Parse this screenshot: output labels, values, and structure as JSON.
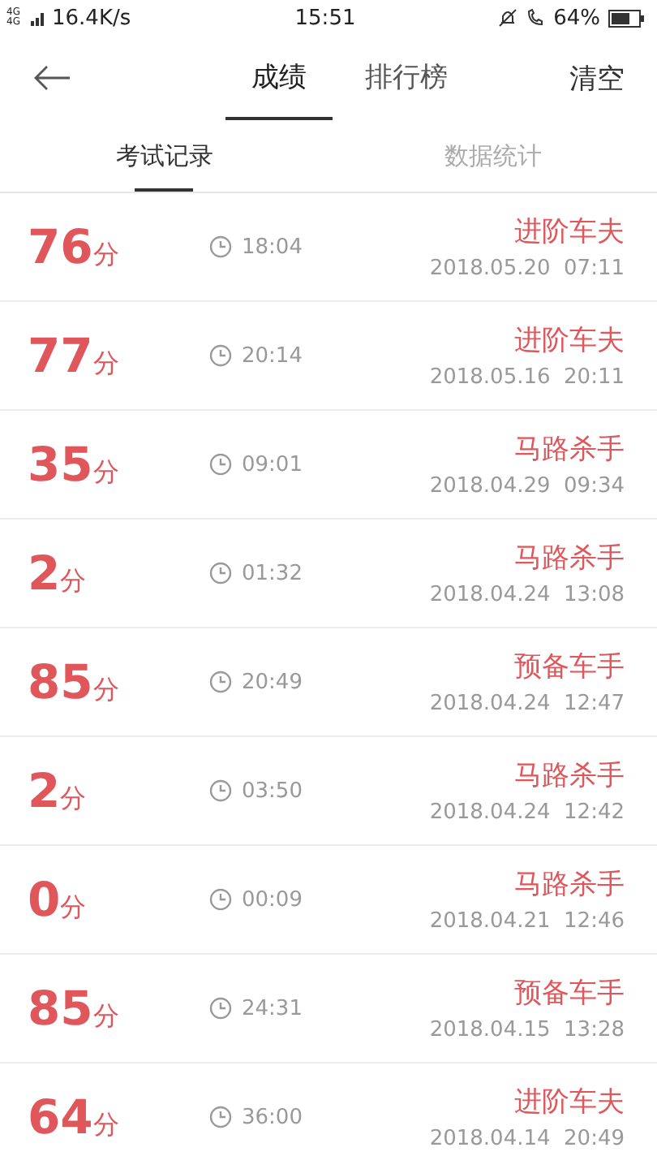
{
  "status_bar": {
    "signal": "4G 4G",
    "speed": "16.4K/s",
    "time": "15:51",
    "battery": "64%"
  },
  "header": {
    "tabs": [
      {
        "label": "成绩",
        "selected": true
      },
      {
        "label": "排行榜",
        "selected": false
      }
    ],
    "action": "清空"
  },
  "subtabs": [
    {
      "label": "考试记录",
      "selected": true
    },
    {
      "label": "数据统计",
      "selected": false
    }
  ],
  "records": [
    {
      "score": "76",
      "unit": "分",
      "duration": "18:04",
      "title": "进阶车夫",
      "date": "2018.05.20  07:11"
    },
    {
      "score": "77",
      "unit": "分",
      "duration": "20:14",
      "title": "进阶车夫",
      "date": "2018.05.16  20:11"
    },
    {
      "score": "35",
      "unit": "分",
      "duration": "09:01",
      "title": "马路杀手",
      "date": "2018.04.29  09:34"
    },
    {
      "score": "2",
      "unit": "分",
      "duration": "01:32",
      "title": "马路杀手",
      "date": "2018.04.24  13:08"
    },
    {
      "score": "85",
      "unit": "分",
      "duration": "20:49",
      "title": "预备车手",
      "date": "2018.04.24  12:47"
    },
    {
      "score": "2",
      "unit": "分",
      "duration": "03:50",
      "title": "马路杀手",
      "date": "2018.04.24  12:42"
    },
    {
      "score": "0",
      "unit": "分",
      "duration": "00:09",
      "title": "马路杀手",
      "date": "2018.04.21  12:46"
    },
    {
      "score": "85",
      "unit": "分",
      "duration": "24:31",
      "title": "预备车手",
      "date": "2018.04.15  13:28"
    },
    {
      "score": "64",
      "unit": "分",
      "duration": "36:00",
      "title": "进阶车夫",
      "date": "2018.04.14  20:49"
    }
  ]
}
